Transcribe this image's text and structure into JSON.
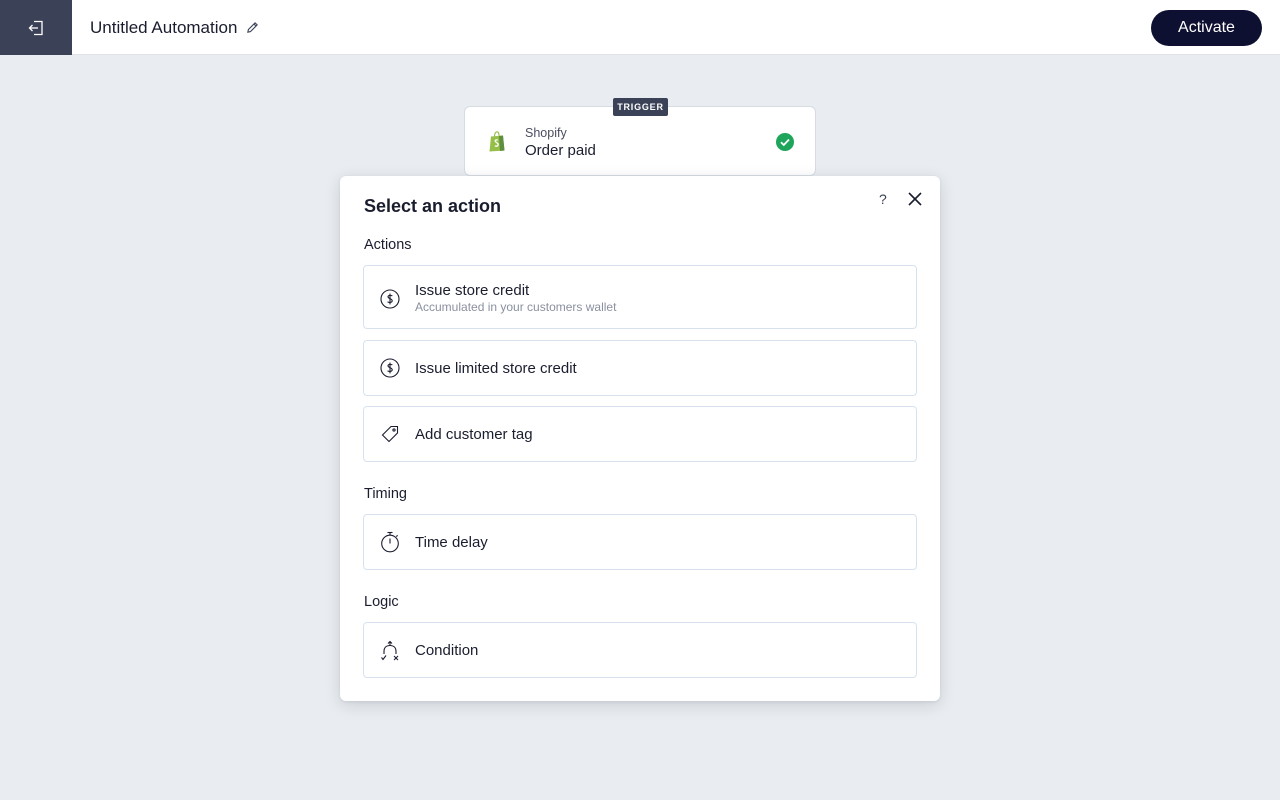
{
  "header": {
    "title": "Untitled Automation",
    "activate_label": "Activate"
  },
  "trigger": {
    "badge": "TRIGGER",
    "app": "Shopify",
    "event": "Order paid"
  },
  "modal": {
    "title": "Select an action",
    "help_label": "?",
    "sections": {
      "actions": {
        "label": "Actions",
        "items": [
          {
            "label": "Issue store credit",
            "sublabel": "Accumulated in your customers wallet",
            "icon": "dollar-circle-icon"
          },
          {
            "label": "Issue limited store credit",
            "icon": "dollar-circle-icon"
          },
          {
            "label": "Add customer tag",
            "icon": "tag-icon"
          }
        ]
      },
      "timing": {
        "label": "Timing",
        "items": [
          {
            "label": "Time delay",
            "icon": "stopwatch-icon"
          }
        ]
      },
      "logic": {
        "label": "Logic",
        "items": [
          {
            "label": "Condition",
            "icon": "condition-branch-icon"
          }
        ]
      }
    }
  },
  "colors": {
    "background": "#e9edf1",
    "exit_button": "#3b4257",
    "activate_button": "#0d1030",
    "success": "#1fa55b",
    "shopify_green": "#95bf47",
    "option_border": "#d6e3ee"
  }
}
